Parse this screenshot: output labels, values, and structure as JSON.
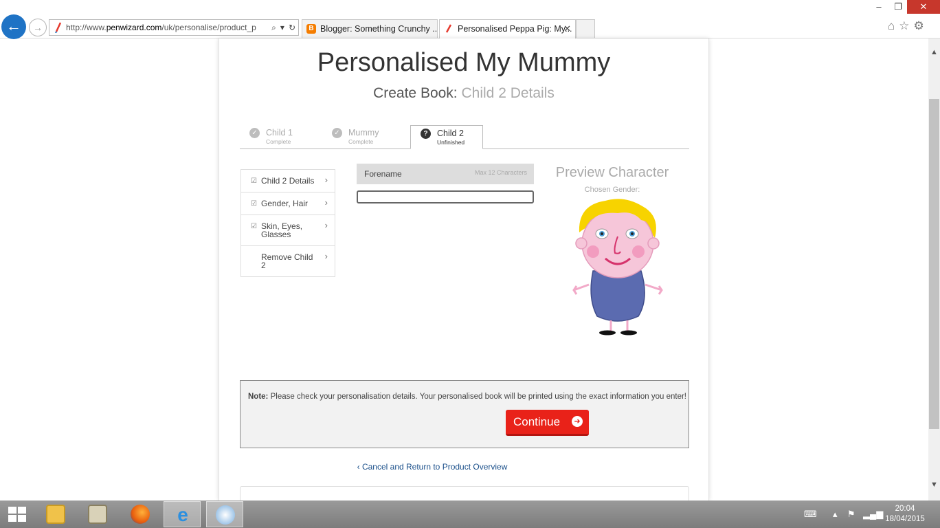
{
  "browser": {
    "url_prefix": "http://www.",
    "url_domain": "penwizard.com",
    "url_rest": "/uk/personalise/product_p",
    "tabs": [
      {
        "label": "Blogger: Something Crunchy ..."
      },
      {
        "label": "Personalised Peppa Pig: My..."
      }
    ],
    "tab_close": "✕"
  },
  "page": {
    "title": "Personalised My Mummy",
    "subtitle_prefix": "Create Book:",
    "subtitle_section": "Child 2 Details",
    "steps": [
      {
        "name": "Child 1",
        "state": "Complete"
      },
      {
        "name": "Mummy",
        "state": "Complete"
      },
      {
        "name": "Child 2",
        "state": "Unfinished"
      }
    ],
    "side_menu": [
      {
        "label": "Child 2 Details"
      },
      {
        "label": "Gender, Hair"
      },
      {
        "label": "Skin, Eyes, Glasses"
      },
      {
        "label": "Remove Child 2"
      }
    ],
    "forename": {
      "label": "Forename",
      "hint": "Max 12 Characters",
      "value": ""
    },
    "preview": {
      "title": "Preview Character",
      "gender_label": "Chosen Gender:"
    },
    "note": {
      "label": "Note:",
      "text": "Please check your personalisation details. Your personalised book will be printed using the exact information you enter!"
    },
    "continue_label": "Continue",
    "cancel_label": "Cancel and Return to Product Overview"
  },
  "taskbar": {
    "time": "20:04",
    "date": "18/04/2015"
  },
  "colors": {
    "accent_red": "#e92219",
    "ie_blue": "#1f73c5",
    "link_blue": "#1a4f8a"
  }
}
